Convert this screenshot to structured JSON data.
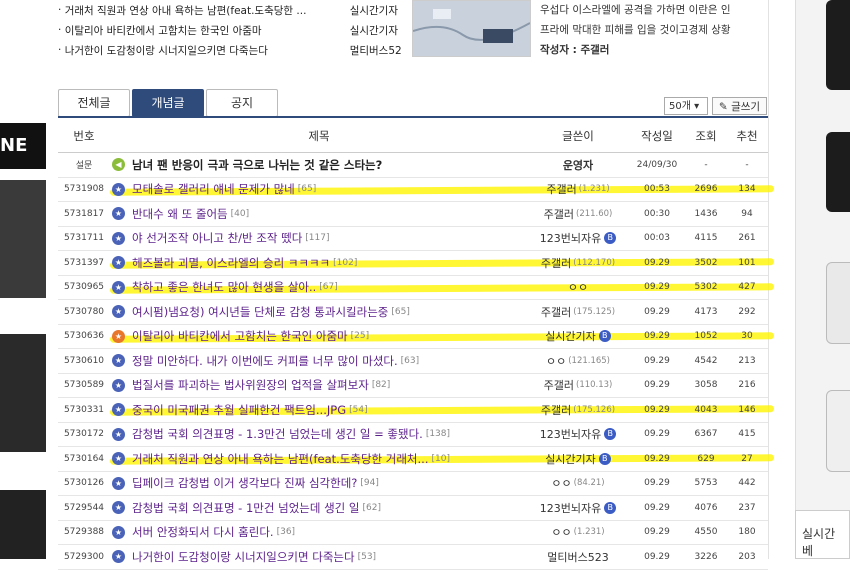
{
  "top_list": [
    {
      "title": "거래처 직원과 연상 아내 욕하는 남편(feat.도축당한 ...",
      "writer": "실시간기자"
    },
    {
      "title": "이탈리아 바티칸에서 고함치는 한국인 아줌마",
      "writer": "실시간기자"
    },
    {
      "title": "나거한이 도감청이랑 시너지일으키면 다죽는다",
      "writer": "멀티버스52"
    }
  ],
  "preview": {
    "line1": "우섭다 이스라엘에 공격을 가하면 이란은 인",
    "line2": "프라에 막대한 피해를 입을 것이고경제 상황",
    "author_label": "작성자 : 주갤러"
  },
  "tabs": [
    "전체글",
    "개념글",
    "공지"
  ],
  "active_tab": 1,
  "per_page": "50개",
  "write_button": "글쓰기",
  "left_ad_text": "NE",
  "realtime_label": "실시간 베",
  "headers": {
    "num": "번호",
    "title": "제목",
    "writer": "글쓴이",
    "date": "작성일",
    "views": "조회",
    "rec": "추천"
  },
  "rows": [
    {
      "num": "설문",
      "title": "남녀 팬 반응이 극과 극으로 나뉘는 것 같은 스타는?",
      "comments": "",
      "writer": "운영자",
      "ip": "",
      "badge": false,
      "date": "24/09/30",
      "views": "-",
      "rec": "-",
      "icon": "speaker",
      "highlight": false,
      "notice": true
    },
    {
      "num": "5731908",
      "title": "모태솔로 갤러리 얘네 문제가 많네",
      "comments": "[65]",
      "writer": "주갤러",
      "ip": "(1.231)",
      "badge": false,
      "date": "00:53",
      "views": "2696",
      "rec": "134",
      "icon": "star",
      "highlight": true
    },
    {
      "num": "5731817",
      "title": "반대수 왜 또 줄어듬",
      "comments": "[40]",
      "writer": "주갤러",
      "ip": "(211.60)",
      "badge": false,
      "date": "00:30",
      "views": "1436",
      "rec": "94",
      "icon": "star",
      "highlight": false
    },
    {
      "num": "5731711",
      "title": "야 선거조작 아니고 찬/반 조작 뗐다",
      "comments": "[117]",
      "writer": "123번뇌자유",
      "ip": "",
      "badge": true,
      "date": "00:03",
      "views": "4115",
      "rec": "261",
      "icon": "star",
      "highlight": false
    },
    {
      "num": "5731397",
      "title": "헤즈볼라 괴멸, 이스라엘의 승리 ㅋㅋㅋㅋ",
      "comments": "[102]",
      "writer": "주갤러",
      "ip": "(112.170)",
      "badge": false,
      "date": "09.29",
      "views": "3502",
      "rec": "101",
      "icon": "star",
      "highlight": true
    },
    {
      "num": "5730965",
      "title": "착하고 좋은 한녀도 많아 현생을 살아..",
      "comments": "[67]",
      "writer": "ㅇㅇ",
      "ip": "",
      "badge": false,
      "date": "09.29",
      "views": "5302",
      "rec": "427",
      "icon": "star",
      "highlight": true
    },
    {
      "num": "5730780",
      "title": "여시펌)냄요청) 여시년들 단체로 감청 통과시킬라는중",
      "comments": "[65]",
      "writer": "주갤러",
      "ip": "(175.125)",
      "badge": false,
      "date": "09.29",
      "views": "4173",
      "rec": "292",
      "icon": "star",
      "highlight": false
    },
    {
      "num": "5730636",
      "title": "이탈리아 바티칸에서 고함치는 한국인 아줌마",
      "comments": "[25]",
      "writer": "실시간기자",
      "ip": "",
      "badge": true,
      "date": "09.29",
      "views": "1052",
      "rec": "30",
      "icon": "orange",
      "highlight": true
    },
    {
      "num": "5730610",
      "title": "정말 미안하다. 내가 이번에도 커피를 너무 많이 마셨다.",
      "comments": "[63]",
      "writer": "ㅇㅇ",
      "ip": "(121.165)",
      "badge": false,
      "date": "09.29",
      "views": "4542",
      "rec": "213",
      "icon": "star",
      "highlight": false
    },
    {
      "num": "5730589",
      "title": "법질서를 파괴하는 법사위원장의 업적을 살펴보자",
      "comments": "[82]",
      "writer": "주갤러",
      "ip": "(110.13)",
      "badge": false,
      "date": "09.29",
      "views": "3058",
      "rec": "216",
      "icon": "star",
      "highlight": false
    },
    {
      "num": "5730331",
      "title": "중국이 미국패권 추월 실패한건 팩트임...JPG",
      "comments": "[54]",
      "writer": "주갤러",
      "ip": "(175.126)",
      "badge": false,
      "date": "09.29",
      "views": "4043",
      "rec": "146",
      "icon": "star",
      "highlight": true
    },
    {
      "num": "5730172",
      "title": "감청법 국회 의견표명 - 1.3만건 넘었는데 생긴 일 = 좋됐다.",
      "comments": "[138]",
      "writer": "123번뇌자유",
      "ip": "",
      "badge": true,
      "date": "09.29",
      "views": "6367",
      "rec": "415",
      "icon": "star",
      "highlight": false
    },
    {
      "num": "5730164",
      "title": "거래처 직원과 연상 아내 욕하는 남편(feat.도축당한 거래처...",
      "comments": "[10]",
      "writer": "실시간기자",
      "ip": "",
      "badge": true,
      "date": "09.29",
      "views": "629",
      "rec": "27",
      "icon": "star",
      "highlight": true
    },
    {
      "num": "5730126",
      "title": "딥페이크 감청법 이거 생각보다 진짜 심각한데?",
      "comments": "[94]",
      "writer": "ㅇㅇ",
      "ip": "(84.21)",
      "badge": false,
      "date": "09.29",
      "views": "5753",
      "rec": "442",
      "icon": "star",
      "highlight": false
    },
    {
      "num": "5729544",
      "title": "감청법 국회 의견표명 - 1만건 넘었는데 생긴 일",
      "comments": "[62]",
      "writer": "123번뇌자유",
      "ip": "",
      "badge": true,
      "date": "09.29",
      "views": "4076",
      "rec": "237",
      "icon": "star",
      "highlight": false
    },
    {
      "num": "5729388",
      "title": "서버 안정화되서 다시 홈린다.",
      "comments": "[36]",
      "writer": "ㅇㅇ",
      "ip": "(1.231)",
      "badge": false,
      "date": "09.29",
      "views": "4550",
      "rec": "180",
      "icon": "star",
      "highlight": false
    },
    {
      "num": "5729300",
      "title": "나거한이 도감청이랑 시너지일으키면 다죽는다",
      "comments": "[53]",
      "writer": "멀티버스523",
      "ip": "",
      "badge": false,
      "date": "09.29",
      "views": "3226",
      "rec": "203",
      "icon": "star",
      "highlight": false
    }
  ]
}
